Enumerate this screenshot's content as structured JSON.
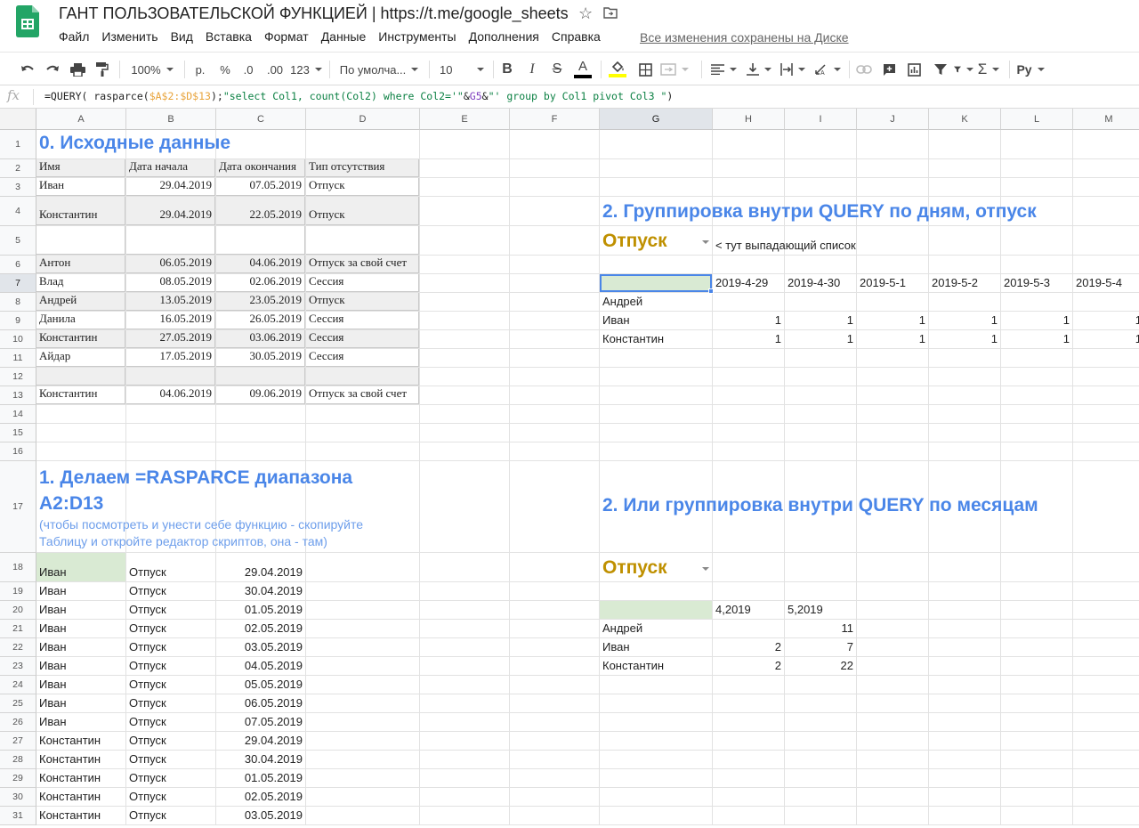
{
  "doc": {
    "title": "ГАНТ ПОЛЬЗОВАТЕЛЬСКОЙ ФУНКЦИЕЙ | https://t.me/google_sheets",
    "save_status": "Все изменения сохранены на Диске"
  },
  "menu": [
    "Файл",
    "Изменить",
    "Вид",
    "Вставка",
    "Формат",
    "Данные",
    "Инструменты",
    "Дополнения",
    "Справка"
  ],
  "toolbar": {
    "zoom": "100%",
    "currency": "р.",
    "percent": "%",
    "dec_less": ".0",
    "dec_more": ".00",
    "more_formats": "123",
    "font": "По умолча...",
    "font_size": "10",
    "input_tools": "Pу",
    "colors": {
      "text_color_bar": "#000000",
      "fill_color_bar": "#ffff00"
    }
  },
  "formula_bar": {
    "fx": "fx",
    "parts": [
      {
        "t": "=QUERY( rasparce(",
        "c": "plain"
      },
      {
        "t": "$A$2:$D$13",
        "c": "ref"
      },
      {
        "t": ");",
        "c": "plain"
      },
      {
        "t": "\"select Col1, count(Col2) where Col2='\"",
        "c": "str"
      },
      {
        "t": "&",
        "c": "plain"
      },
      {
        "t": "G5",
        "c": "ref2"
      },
      {
        "t": "&",
        "c": "plain"
      },
      {
        "t": "\"' group by Col1 pivot Col3 \"",
        "c": "str"
      },
      {
        "t": ")",
        "c": "plain"
      }
    ]
  },
  "columns": [
    "A",
    "B",
    "C",
    "D",
    "E",
    "F",
    "G",
    "H",
    "I",
    "J",
    "K",
    "L",
    "M"
  ],
  "rows": [
    "1",
    "2",
    "3",
    "4",
    "5",
    "6",
    "7",
    "8",
    "9",
    "10",
    "11",
    "12",
    "13",
    "14",
    "15",
    "16",
    "17",
    "18",
    "19",
    "20",
    "21",
    "22",
    "23",
    "24",
    "25",
    "26",
    "27",
    "28",
    "29",
    "30",
    "31"
  ],
  "source": {
    "heading": "0. Исходные данные",
    "headers": [
      "Имя",
      "Дата начала",
      "Дата окончания",
      "Тип отсутствия"
    ],
    "rows": [
      [
        "Иван",
        "29.04.2019",
        "07.05.2019",
        "Отпуск"
      ],
      [
        "Константин",
        "29.04.2019",
        "22.05.2019",
        "Отпуск"
      ],
      [
        "",
        "",
        "",
        ""
      ],
      [
        "Антон",
        "06.05.2019",
        "04.06.2019",
        "Отпуск за свой счет"
      ],
      [
        "Влад",
        "08.05.2019",
        "02.06.2019",
        "Сессия"
      ],
      [
        "Андрей",
        "13.05.2019",
        "23.05.2019",
        "Отпуск"
      ],
      [
        "Данила",
        "16.05.2019",
        "26.05.2019",
        "Сессия"
      ],
      [
        "Константин",
        "27.05.2019",
        "03.06.2019",
        "Сессия"
      ],
      [
        "Айдар",
        "17.05.2019",
        "30.05.2019",
        "Сессия"
      ],
      [
        "",
        "",
        "",
        ""
      ],
      [
        "Константин",
        "04.06.2019",
        "09.06.2019",
        "Отпуск за свой счет"
      ]
    ]
  },
  "rasparce": {
    "heading": "1. Делаем =RASPARCE диапазона A2:D13",
    "subheading": "(чтобы посмотреть и унести себе функцию - скопируйте Таблицу и откройте редактор скриптов, она - там)",
    "rows": [
      [
        "Иван",
        "Отпуск",
        "29.04.2019"
      ],
      [
        "Иван",
        "Отпуск",
        "30.04.2019"
      ],
      [
        "Иван",
        "Отпуск",
        "01.05.2019"
      ],
      [
        "Иван",
        "Отпуск",
        "02.05.2019"
      ],
      [
        "Иван",
        "Отпуск",
        "03.05.2019"
      ],
      [
        "Иван",
        "Отпуск",
        "04.05.2019"
      ],
      [
        "Иван",
        "Отпуск",
        "05.05.2019"
      ],
      [
        "Иван",
        "Отпуск",
        "06.05.2019"
      ],
      [
        "Иван",
        "Отпуск",
        "07.05.2019"
      ],
      [
        "Константин",
        "Отпуск",
        "29.04.2019"
      ],
      [
        "Константин",
        "Отпуск",
        "30.04.2019"
      ],
      [
        "Константин",
        "Отпуск",
        "01.05.2019"
      ],
      [
        "Константин",
        "Отпуск",
        "02.05.2019"
      ],
      [
        "Константин",
        "Отпуск",
        "03.05.2019"
      ]
    ]
  },
  "by_days": {
    "heading": "2. Группировка внутри QUERY по дням, отпуск",
    "dropdown_value": "Отпуск",
    "dropdown_note": "< тут выпадающий список",
    "dates": [
      "2019-4-29",
      "2019-4-30",
      "2019-5-1",
      "2019-5-2",
      "2019-5-3",
      "2019-5-4"
    ],
    "rows": [
      {
        "name": "Андрей",
        "values": [
          "",
          "",
          "",
          "",
          "",
          ""
        ]
      },
      {
        "name": "Иван",
        "values": [
          "1",
          "1",
          "1",
          "1",
          "1",
          "1"
        ]
      },
      {
        "name": "Константин",
        "values": [
          "1",
          "1",
          "1",
          "1",
          "1",
          "1"
        ]
      }
    ]
  },
  "by_months": {
    "heading": "2. Или группировка внутри QUERY по месяцам",
    "dropdown_value": "Отпуск",
    "months": [
      "4,2019",
      "5,2019"
    ],
    "rows": [
      {
        "name": "Андрей",
        "values": [
          "",
          "11"
        ]
      },
      {
        "name": "Иван",
        "values": [
          "2",
          "7"
        ]
      },
      {
        "name": "Константин",
        "values": [
          "2",
          "22"
        ]
      }
    ]
  }
}
